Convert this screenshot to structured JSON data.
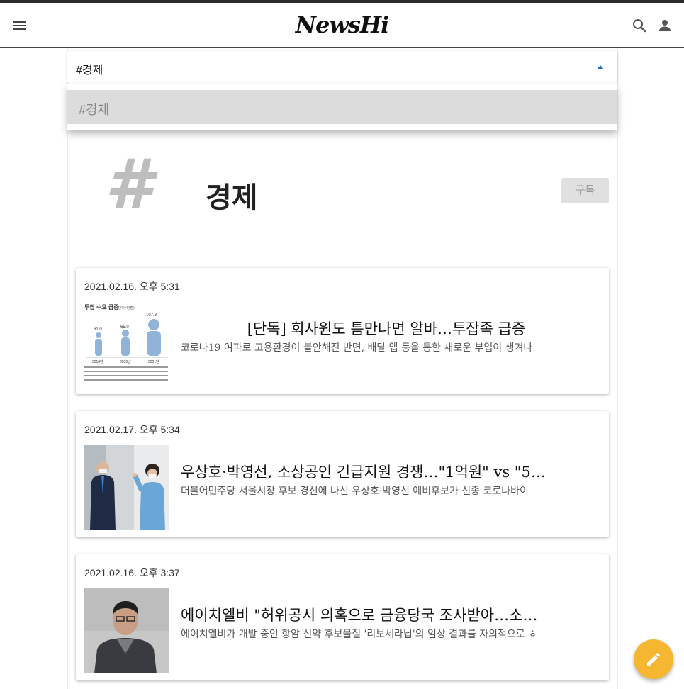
{
  "app": {
    "logo": "NewsHi"
  },
  "header": {
    "menu_icon": "menu-icon",
    "search_icon": "search-icon",
    "account_icon": "account-icon"
  },
  "tag_select": {
    "selected": "#경제",
    "options": [
      "#경제"
    ]
  },
  "tag_header": {
    "glyph": "#",
    "title": "경제",
    "subscribe_label": "구독"
  },
  "articles": [
    {
      "date": "2021.02.16. 오후 5:31",
      "title": "[단독] 회사원도 틈만나면 알바…투잡족 급증",
      "summary": "코로나19 여파로 고용환경이 불안해진 반면, 배달 앱 등을 통한 새로운 부업이 생겨나",
      "thumb": {
        "chart_title": "투잡 수요 급증",
        "chart_unit": "(단위=만명)",
        "values": [
          "61.0",
          "65.0",
          "107.8"
        ],
        "years": [
          "2019년",
          "2020년",
          "2021년"
        ]
      }
    },
    {
      "date": "2021.02.17. 오후 5:34",
      "title": "우상호·박영선, 소상공인 긴급지원 경쟁…\"1억원\" vs \"5…",
      "summary": "더불어민주당 서울시장 후보 경선에 나선 우상호·박영선 예비후보가 신종 코로나바이"
    },
    {
      "date": "2021.02.16. 오후 3:37",
      "title": "에이치엘비 \"허위공시 의혹으로 금융당국 조사받아…소…",
      "summary": "에이치엘비가 개발 중인 항암 신약 후보물질 '리보세라닙'의 임상 결과를 자의적으로 ㅎ"
    }
  ],
  "fab": {
    "icon": "pencil-icon"
  },
  "colors": {
    "accent": "#1a73c8",
    "fab": "#f5b731",
    "hash": "#bdbdbd"
  }
}
